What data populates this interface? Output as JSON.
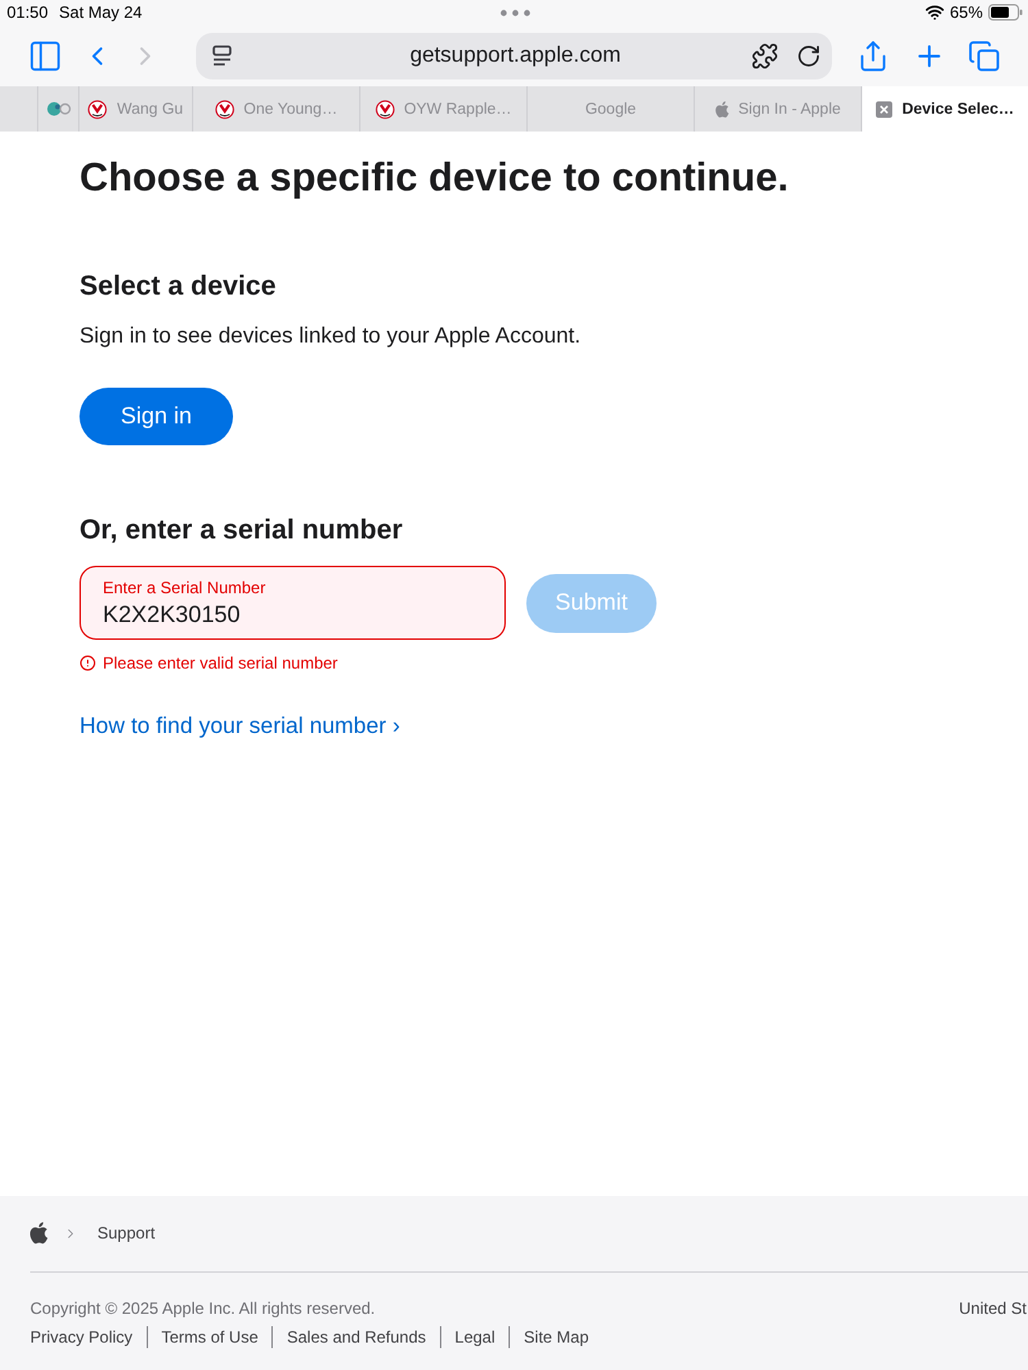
{
  "status_bar": {
    "time": "01:50",
    "date": "Sat May 24",
    "battery": "65%"
  },
  "toolbar": {
    "back": {
      "disabled": false
    },
    "forward": {
      "disabled": true
    },
    "address": "getsupport.apple.com"
  },
  "tabs": [
    {
      "kind": "pinned",
      "selected": false
    },
    {
      "kind": "logo",
      "title": "Wang Gu",
      "selected": false
    },
    {
      "kind": "logo",
      "title": "One Young…",
      "selected": false
    },
    {
      "kind": "logo",
      "title": "OYW Rapple…",
      "selected": false
    },
    {
      "kind": "plain",
      "title": "Google",
      "selected": false
    },
    {
      "kind": "apple",
      "title": "Sign In - Apple",
      "selected": false
    },
    {
      "kind": "plain",
      "title": "Device Selec…",
      "selected": true
    }
  ],
  "page": {
    "heading": "Choose a specific device to continue.",
    "device_section": {
      "title": "Select a device",
      "text": "Sign in to see devices linked to your Apple Account.",
      "button": "Sign in"
    },
    "serial_section": {
      "title": "Or, enter a serial number",
      "field": {
        "label": "Enter a Serial Number",
        "value": "K2X2K30150",
        "invalid": true,
        "error": "Please enter valid serial number"
      },
      "submit": {
        "label": "Submit",
        "disabled": true
      },
      "help_link": "How to find your serial number ›"
    }
  },
  "footer": {
    "breadcrumb": [
      "Support"
    ],
    "copyright": "Copyright © 2025 Apple Inc. All rights reserved.",
    "region": "United St",
    "links": [
      "Privacy Policy",
      "Terms of Use",
      "Sales and Refunds",
      "Legal",
      "Site Map"
    ]
  }
}
